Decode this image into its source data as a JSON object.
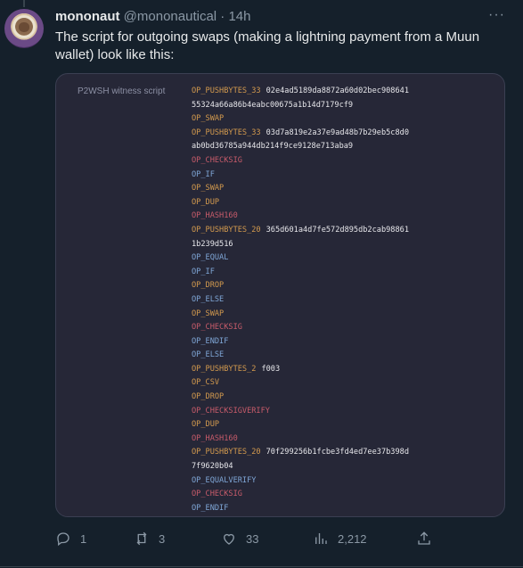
{
  "tweet": {
    "author_name": "mononaut",
    "author_handle": "@mononautical",
    "separator": "·",
    "time": "14h",
    "text": "The script for outgoing swaps (making a lightning payment from a Muun wallet) look like this:",
    "more_label": "···"
  },
  "code_card": {
    "label": "P2WSH witness script",
    "lines": [
      {
        "op": "OP_PUSHBYTES_33",
        "type": "orange",
        "arg": "02e4ad5189da8872a60d02bec908641"
      },
      {
        "op": "",
        "type": "orange",
        "arg": "55324a66a86b4eabc00675a1b14d7179cf9"
      },
      {
        "op": "OP_SWAP",
        "type": "orange",
        "arg": ""
      },
      {
        "op": "OP_PUSHBYTES_33",
        "type": "orange",
        "arg": "03d7a819e2a37e9ad48b7b29eb5c8d0"
      },
      {
        "op": "",
        "type": "orange",
        "arg": "ab0bd36785a944db214f9ce9128e713aba9"
      },
      {
        "op": "OP_CHECKSIG",
        "type": "red",
        "arg": ""
      },
      {
        "op": "OP_IF",
        "type": "blue",
        "arg": ""
      },
      {
        "op": "OP_SWAP",
        "type": "orange",
        "arg": ""
      },
      {
        "op": "OP_DUP",
        "type": "orange",
        "arg": ""
      },
      {
        "op": "OP_HASH160",
        "type": "red",
        "arg": ""
      },
      {
        "op": "OP_PUSHBYTES_20",
        "type": "orange",
        "arg": "365d601a4d7fe572d895db2cab98861"
      },
      {
        "op": "",
        "type": "orange",
        "arg": "1b239d516"
      },
      {
        "op": "OP_EQUAL",
        "type": "blue",
        "arg": ""
      },
      {
        "op": "OP_IF",
        "type": "blue",
        "arg": ""
      },
      {
        "op": "OP_DROP",
        "type": "orange",
        "arg": ""
      },
      {
        "op": "OP_ELSE",
        "type": "blue",
        "arg": ""
      },
      {
        "op": "OP_SWAP",
        "type": "orange",
        "arg": ""
      },
      {
        "op": "OP_CHECKSIG",
        "type": "red",
        "arg": ""
      },
      {
        "op": "OP_ENDIF",
        "type": "blue",
        "arg": ""
      },
      {
        "op": "OP_ELSE",
        "type": "blue",
        "arg": ""
      },
      {
        "op": "OP_PUSHBYTES_2",
        "type": "orange",
        "arg": "f003"
      },
      {
        "op": "OP_CSV",
        "type": "orange",
        "arg": ""
      },
      {
        "op": "OP_DROP",
        "type": "orange",
        "arg": ""
      },
      {
        "op": "OP_CHECKSIGVERIFY",
        "type": "red",
        "arg": ""
      },
      {
        "op": "OP_DUP",
        "type": "orange",
        "arg": ""
      },
      {
        "op": "OP_HASH160",
        "type": "red",
        "arg": ""
      },
      {
        "op": "OP_PUSHBYTES_20",
        "type": "orange",
        "arg": "70f299256b1fcbe3fd4ed7ee37b398d"
      },
      {
        "op": "",
        "type": "orange",
        "arg": "7f9620b04"
      },
      {
        "op": "OP_EQUALVERIFY",
        "type": "blue",
        "arg": ""
      },
      {
        "op": "OP_CHECKSIG",
        "type": "red",
        "arg": ""
      },
      {
        "op": "OP_ENDIF",
        "type": "blue",
        "arg": ""
      }
    ]
  },
  "actions": {
    "replies": "1",
    "retweets": "3",
    "likes": "33",
    "views": "2,212"
  },
  "icons": {
    "reply": "reply-icon",
    "retweet": "retweet-icon",
    "like": "heart-icon",
    "views": "views-icon",
    "share": "share-icon"
  },
  "colors": {
    "background": "#15202b",
    "card": "#262737",
    "op_orange": "#d39a4e",
    "op_red": "#c75b6a",
    "op_blue": "#7fa6d6"
  }
}
